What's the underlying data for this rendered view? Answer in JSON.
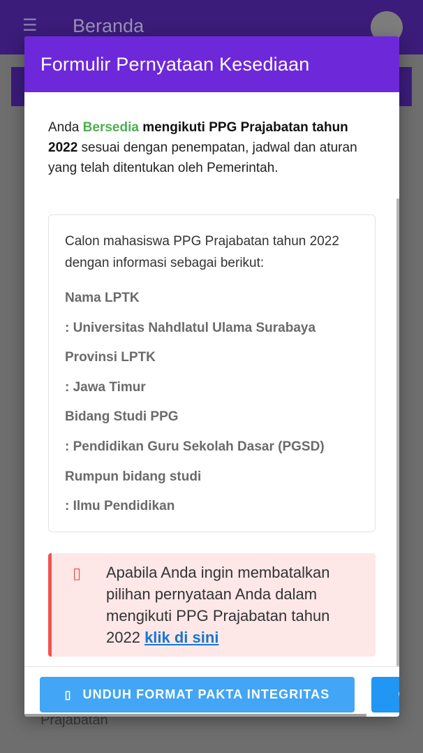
{
  "background": {
    "title": "Beranda",
    "footer_text": "Prajabatan"
  },
  "dialog": {
    "title": "Formulir Pernyataan Kesediaan",
    "intro": {
      "part1": "Anda ",
      "accent": "Bersedia",
      "part2": " ",
      "bold": "mengikuti PPG Prajabatan tahun 2022",
      "part3": " sesuai dengan penempatan, jadwal dan aturan yang telah ditentukan oleh Pemerintah."
    },
    "info": {
      "intro": "Calon mahasiswa PPG Prajabatan tahun 2022 dengan informasi sebagai berikut:",
      "lines": [
        "Nama LPTK",
        ": Universitas Nahdlatul Ulama Surabaya",
        "Provinsi LPTK",
        ": Jawa Timur",
        "Bidang Studi PPG",
        ": Pendidikan Guru Sekolah Dasar (PGSD)",
        "Rumpun bidang studi",
        ": Ilmu Pendidikan"
      ]
    },
    "alert": {
      "text": "Apabila Anda ingin membatalkan pilihan pernyataan Anda dalam mengikuti PPG Prajabatan tahun 2022 ",
      "link": "klik di sini"
    },
    "footer": {
      "primary_label": "UNDUH FORMAT PAKTA INTEGRITAS",
      "secondary_label": "C"
    }
  },
  "colors": {
    "header": "#6d28d9",
    "accent_green": "#4caf50",
    "button_blue": "#42a5f5",
    "alert_red": "#ef5350",
    "link_blue": "#1976d2"
  }
}
